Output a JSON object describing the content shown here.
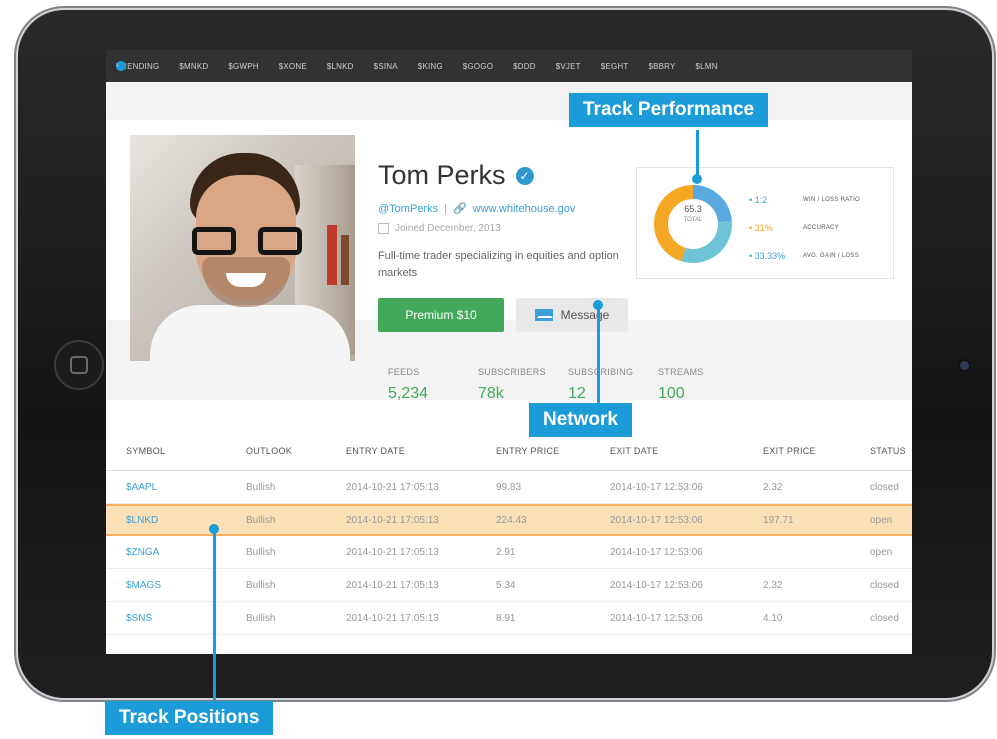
{
  "ticker": {
    "items": [
      "TRENDING",
      "•",
      "$MNKD",
      "$GWPH",
      "$XONE",
      "$LNKD",
      "$SINA",
      "$KING",
      "$GOGO",
      "$DDD",
      "$VJET",
      "$EGHT",
      "$BBRY",
      "$LMN",
      "•"
    ]
  },
  "profile": {
    "name": "Tom Perks",
    "verified_mark": "✓",
    "handle": "@TomPerks",
    "separator": "|",
    "website": "www.whitehouse.gov",
    "joined": "Joined December, 2013",
    "bio": "Full-time trader specializing in equities and option markets",
    "premium_label": "Premium $10",
    "message_label": "Message"
  },
  "stats": [
    {
      "label": "FEEDS",
      "value": "5,234"
    },
    {
      "label": "SUBSCRIBERS",
      "value": "78k"
    },
    {
      "label": "SUBSCRIBING",
      "value": "12"
    },
    {
      "label": "STREAMS",
      "value": "100"
    }
  ],
  "performance": {
    "total_value": "65.3",
    "total_label": "TOTAL",
    "metrics": [
      {
        "value": "1:2",
        "label": "WIN / LOSS RATIO",
        "color": "#3aa1d6"
      },
      {
        "value": "31%",
        "label": "ACCURACY",
        "color": "#f5a623"
      },
      {
        "value": "33.33%",
        "label": "AVG. GAIN / LOSS",
        "color": "#3aa1d6"
      }
    ],
    "donut_colors": [
      "#5aa9e0",
      "#6ec3d6",
      "#f5a623"
    ]
  },
  "table": {
    "headers": [
      "SYMBOL",
      "OUTLOOK",
      "ENTRY DATE",
      "ENTRY PRICE",
      "EXIT DATE",
      "EXIT PRICE",
      "STATUS"
    ],
    "rows": [
      [
        "$AAPL",
        "Bullish",
        "2014-10-21 17:05:13",
        "99.83",
        "2014-10-17 12:53:06",
        "2.32",
        "closed"
      ],
      [
        "$LNKD",
        "Bullish",
        "2014-10-21 17:05:13",
        "224.43",
        "2014-10-17 12:53:06",
        "197.71",
        "open"
      ],
      [
        "$ZNGA",
        "Bullish",
        "2014-10-21 17:05:13",
        "2.91",
        "2014-10-17 12:53:06",
        "",
        "open"
      ],
      [
        "$MAGS",
        "Bullish",
        "2014-10-21 17:05:13",
        "5.34",
        "2014-10-17 12:53:06",
        "2.32",
        "closed"
      ],
      [
        "$SNS",
        "Bullish",
        "2014-10-21 17:05:13",
        "8.91",
        "2014-10-17 12:53:06",
        "4.10",
        "closed"
      ]
    ]
  },
  "callouts": {
    "performance": "Track Performance",
    "network": "Network",
    "positions": "Track Positions"
  },
  "colors": {
    "accent": "#1b9bd7",
    "green": "#43a95a",
    "highlight": "#fbe0b8"
  }
}
